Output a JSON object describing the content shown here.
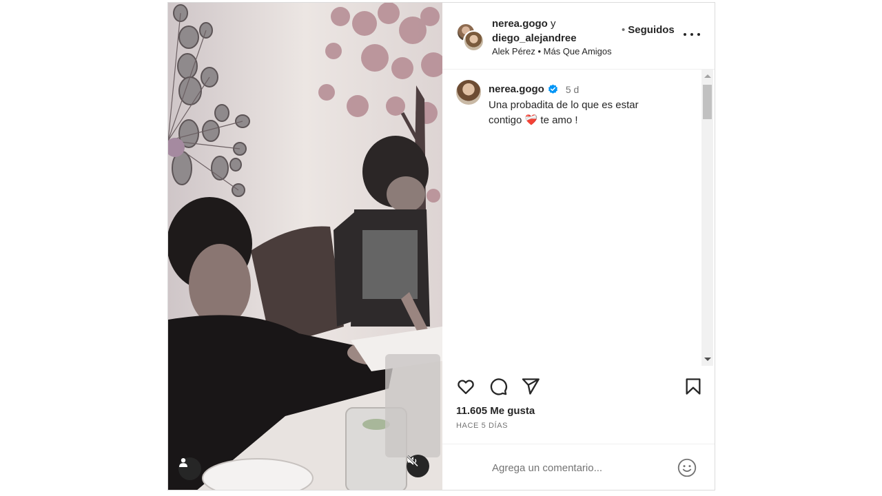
{
  "header": {
    "user1": "nerea.gogo",
    "joiner": "y",
    "user2": "diego_alejandree",
    "music": "Alek Pérez • Más Que Amigos",
    "follow_dot": "•",
    "follow_label": "Seguidos"
  },
  "caption": {
    "username": "nerea.gogo",
    "time": "5 d",
    "text_line1": "Una probadita de lo que es estar",
    "text_line2_start": "contigo",
    "emoji": "❤️‍🩹",
    "text_line2_end": "te amo !"
  },
  "engagement": {
    "likes": "11.605 Me gusta",
    "date": "HACE 5 DÍAS"
  },
  "comment_box": {
    "placeholder": "Agrega un comentario..."
  },
  "icons": {
    "verified": "verified-badge-icon",
    "like": "heart-icon",
    "comment": "comment-icon",
    "share": "send-icon",
    "save": "bookmark-icon",
    "emoji": "smiley-icon",
    "tag": "user-tag-icon",
    "mute": "speaker-muted-icon",
    "more": "more-dots-icon"
  },
  "colors": {
    "verified": "#0095f6",
    "text": "#262626",
    "secondary": "#737373",
    "border": "#dbdbdb"
  }
}
